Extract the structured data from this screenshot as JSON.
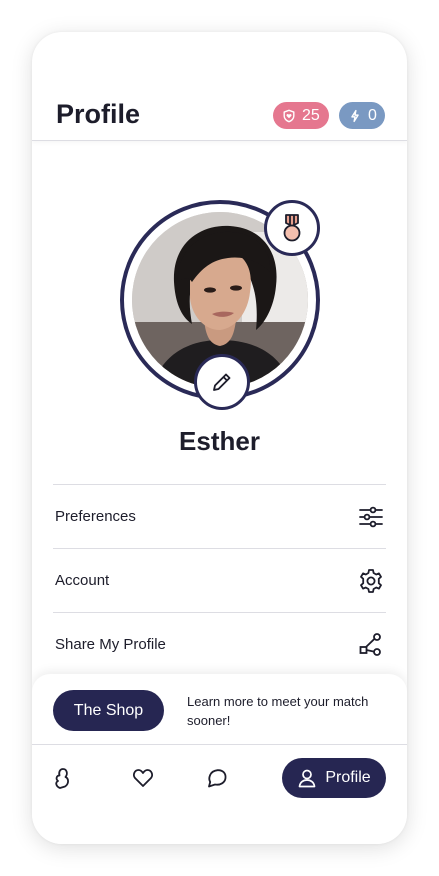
{
  "header": {
    "title": "Profile",
    "likes_badge": {
      "icon": "shield-heart-icon",
      "count": "25",
      "color": "#e5778f"
    },
    "boosts_badge": {
      "icon": "bolt-icon",
      "count": "0",
      "color": "#7a99c2"
    }
  },
  "profile": {
    "name": "Esther",
    "badge_icon": "medal-icon",
    "edit_icon": "pencil-icon",
    "ring_color": "#2a2a57"
  },
  "menu": {
    "items": [
      {
        "label": "Preferences",
        "icon": "sliders-icon"
      },
      {
        "label": "Account",
        "icon": "gear-icon"
      },
      {
        "label": "Share My Profile",
        "icon": "share-icon"
      }
    ]
  },
  "shop": {
    "button_label": "The Shop",
    "description": "Learn more to meet your match sooner!",
    "button_color": "#262652"
  },
  "nav": {
    "items": [
      {
        "icon": "discover-icon"
      },
      {
        "icon": "heart-icon"
      },
      {
        "icon": "chat-icon"
      }
    ],
    "active": {
      "label": "Profile",
      "icon": "user-icon"
    }
  }
}
